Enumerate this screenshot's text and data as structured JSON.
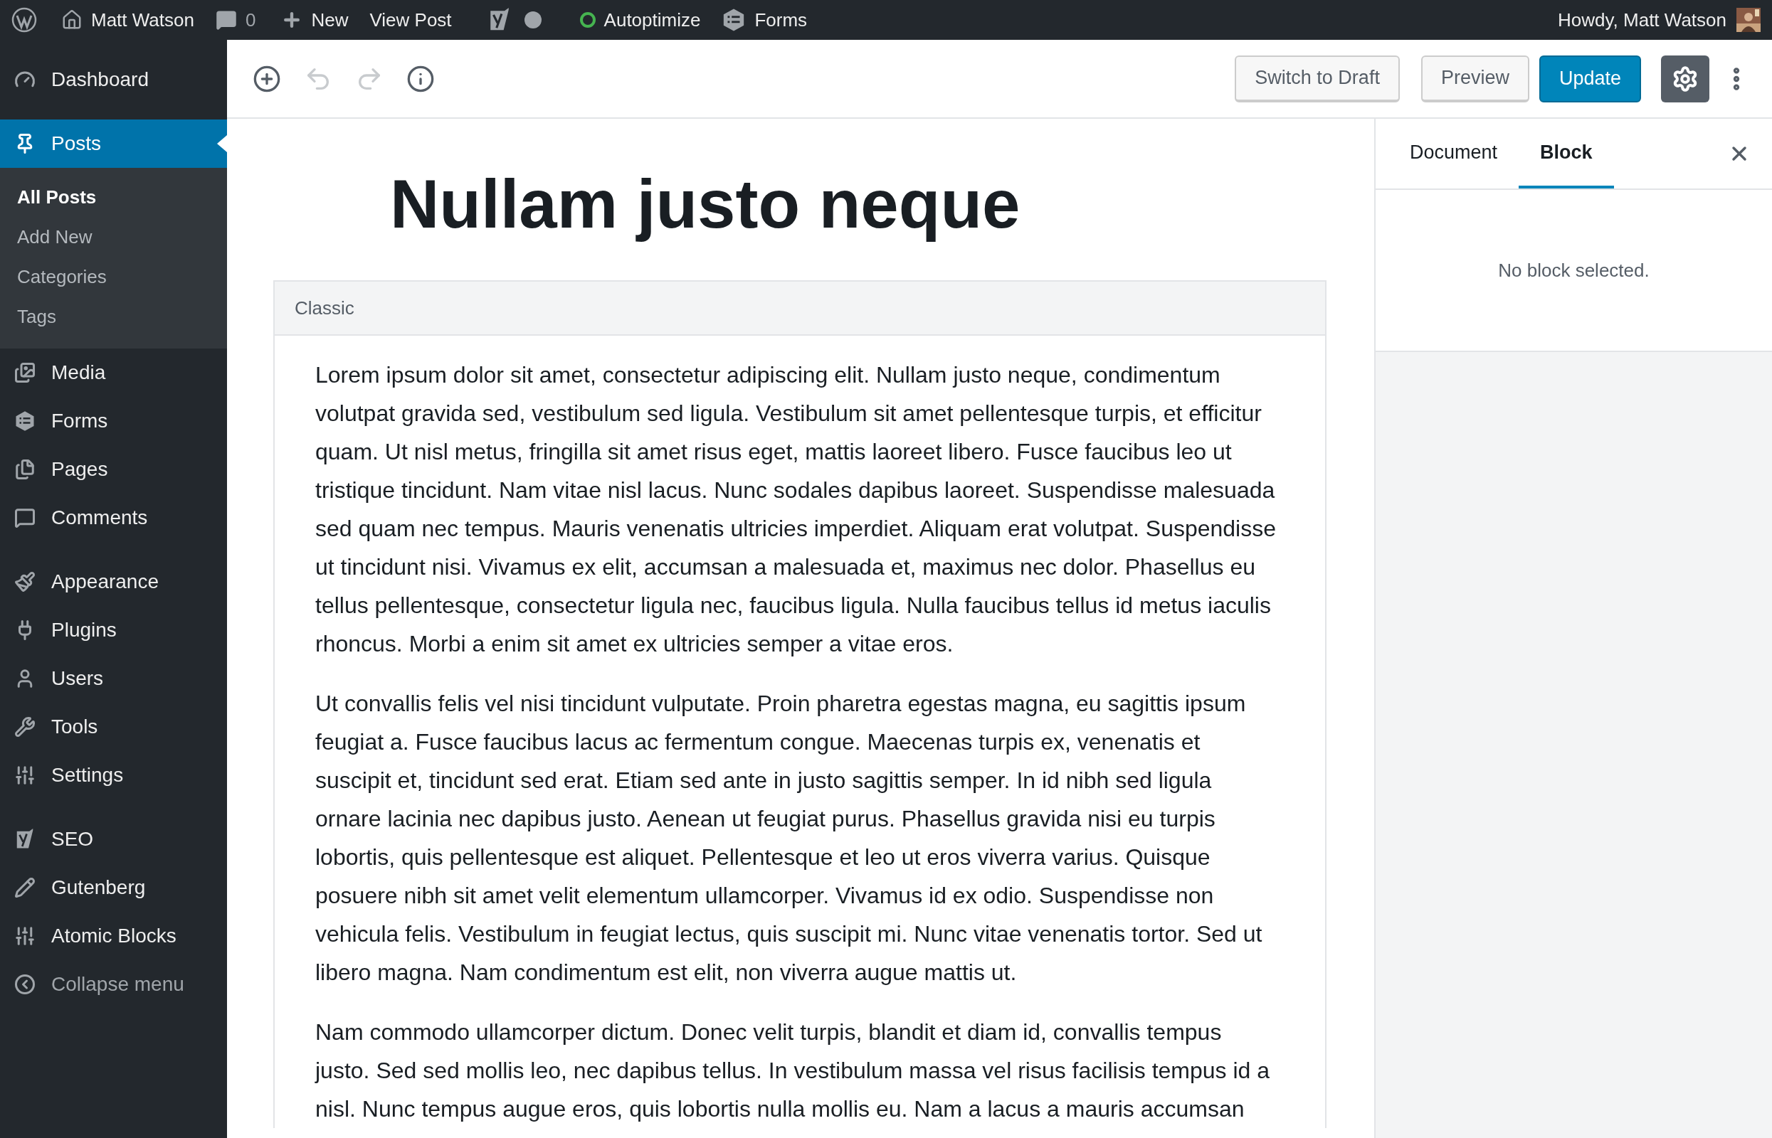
{
  "admin_bar": {
    "items": [
      {
        "label": "Matt Watson"
      },
      {
        "label": "0"
      },
      {
        "label": "New"
      },
      {
        "label": "View Post"
      },
      {
        "label": "Autoptimize"
      },
      {
        "label": "Forms"
      }
    ],
    "greeting": "Howdy, Matt Watson"
  },
  "sidebar": {
    "groups": [
      {
        "items": [
          {
            "label": "Dashboard",
            "selected": false
          }
        ]
      },
      {
        "items": [
          {
            "label": "Posts",
            "selected": true,
            "children": [
              {
                "label": "All Posts",
                "selected": true
              },
              {
                "label": "Add New",
                "selected": false
              },
              {
                "label": "Categories",
                "selected": false
              },
              {
                "label": "Tags",
                "selected": false
              }
            ]
          },
          {
            "label": "Media",
            "selected": false
          },
          {
            "label": "Forms",
            "selected": false
          },
          {
            "label": "Pages",
            "selected": false
          },
          {
            "label": "Comments",
            "selected": false
          }
        ]
      },
      {
        "items": [
          {
            "label": "Appearance",
            "selected": false
          },
          {
            "label": "Plugins",
            "selected": false
          },
          {
            "label": "Users",
            "selected": false
          },
          {
            "label": "Tools",
            "selected": false
          },
          {
            "label": "Settings",
            "selected": false
          }
        ]
      },
      {
        "items": [
          {
            "label": "SEO",
            "selected": false
          },
          {
            "label": "Gutenberg",
            "selected": false
          },
          {
            "label": "Atomic Blocks",
            "selected": false
          },
          {
            "label": "Collapse menu",
            "selected": false
          }
        ]
      }
    ]
  },
  "toolbar": {
    "history": [
      {
        "disabled": true
      },
      {
        "disabled": true
      }
    ],
    "buttons": [
      {
        "label": "Switch to Draft",
        "kind": "secondary"
      },
      {
        "label": "Preview",
        "kind": "secondary"
      },
      {
        "label": "Update",
        "kind": "primary"
      }
    ],
    "settings_toggle": {
      "on": true
    }
  },
  "editor": {
    "title": "Nullam justo neque",
    "block_label": "Classic",
    "paragraphs": [
      "Lorem ipsum dolor sit amet, consectetur adipiscing elit. Nullam justo neque, condimentum\nvolutpat gravida sed, vestibulum sed ligula. Vestibulum sit amet pellentesque turpis, et efficitur\nquam. Ut nisl metus, fringilla sit amet risus eget, mattis laoreet libero. Fusce faucibus leo ut\ntristique tincidunt. Nam vitae nisl lacus. Nunc sodales dapibus laoreet. Suspendisse malesuada\nsed quam nec tempus. Mauris venenatis ultricies imperdiet. Aliquam erat volutpat. Suspendisse\nut tincidunt nisi. Vivamus ex elit, accumsan a malesuada et, maximus nec dolor. Phasellus eu\ntellus pellentesque, consectetur ligula nec, faucibus ligula. Nulla faucibus tellus id metus iaculis\nrhoncus. Morbi a enim sit amet ex ultricies semper a vitae eros.",
      "Ut convallis felis vel nisi tincidunt vulputate. Proin pharetra egestas magna, eu sagittis ipsum\nfeugiat a. Fusce faucibus lacus ac fermentum congue. Maecenas turpis ex, venenatis et\nsuscipit et, tincidunt sed erat. Etiam sed ante in justo sagittis semper. In id nibh sed ligula\nornare lacinia nec dapibus justo. Aenean ut feugiat purus. Phasellus gravida nisi eu turpis\nlobortis, quis pellentesque est aliquet. Pellentesque et leo ut eros viverra varius. Quisque\nposuere nibh sit amet velit elementum ullamcorper. Vivamus id ex odio. Suspendisse non\nvehicula felis. Vestibulum in feugiat lectus, quis suscipit mi. Nunc vitae venenatis tortor. Sed ut\nlibero magna. Nam condimentum est elit, non viverra augue mattis ut.",
      "Nam commodo ullamcorper dictum. Donec velit turpis, blandit et diam id, convallis tempus\njusto. Sed sed mollis leo, nec dapibus tellus. In vestibulum massa vel risus facilisis tempus id a\nnisl. Nunc tempus augue eros, quis lobortis nulla mollis eu. Nam a lacus a mauris accumsan"
    ]
  },
  "settings_panel": {
    "tabs": [
      {
        "label": "Document",
        "selected": false
      },
      {
        "label": "Block",
        "selected": true
      }
    ],
    "message": "No block selected."
  }
}
